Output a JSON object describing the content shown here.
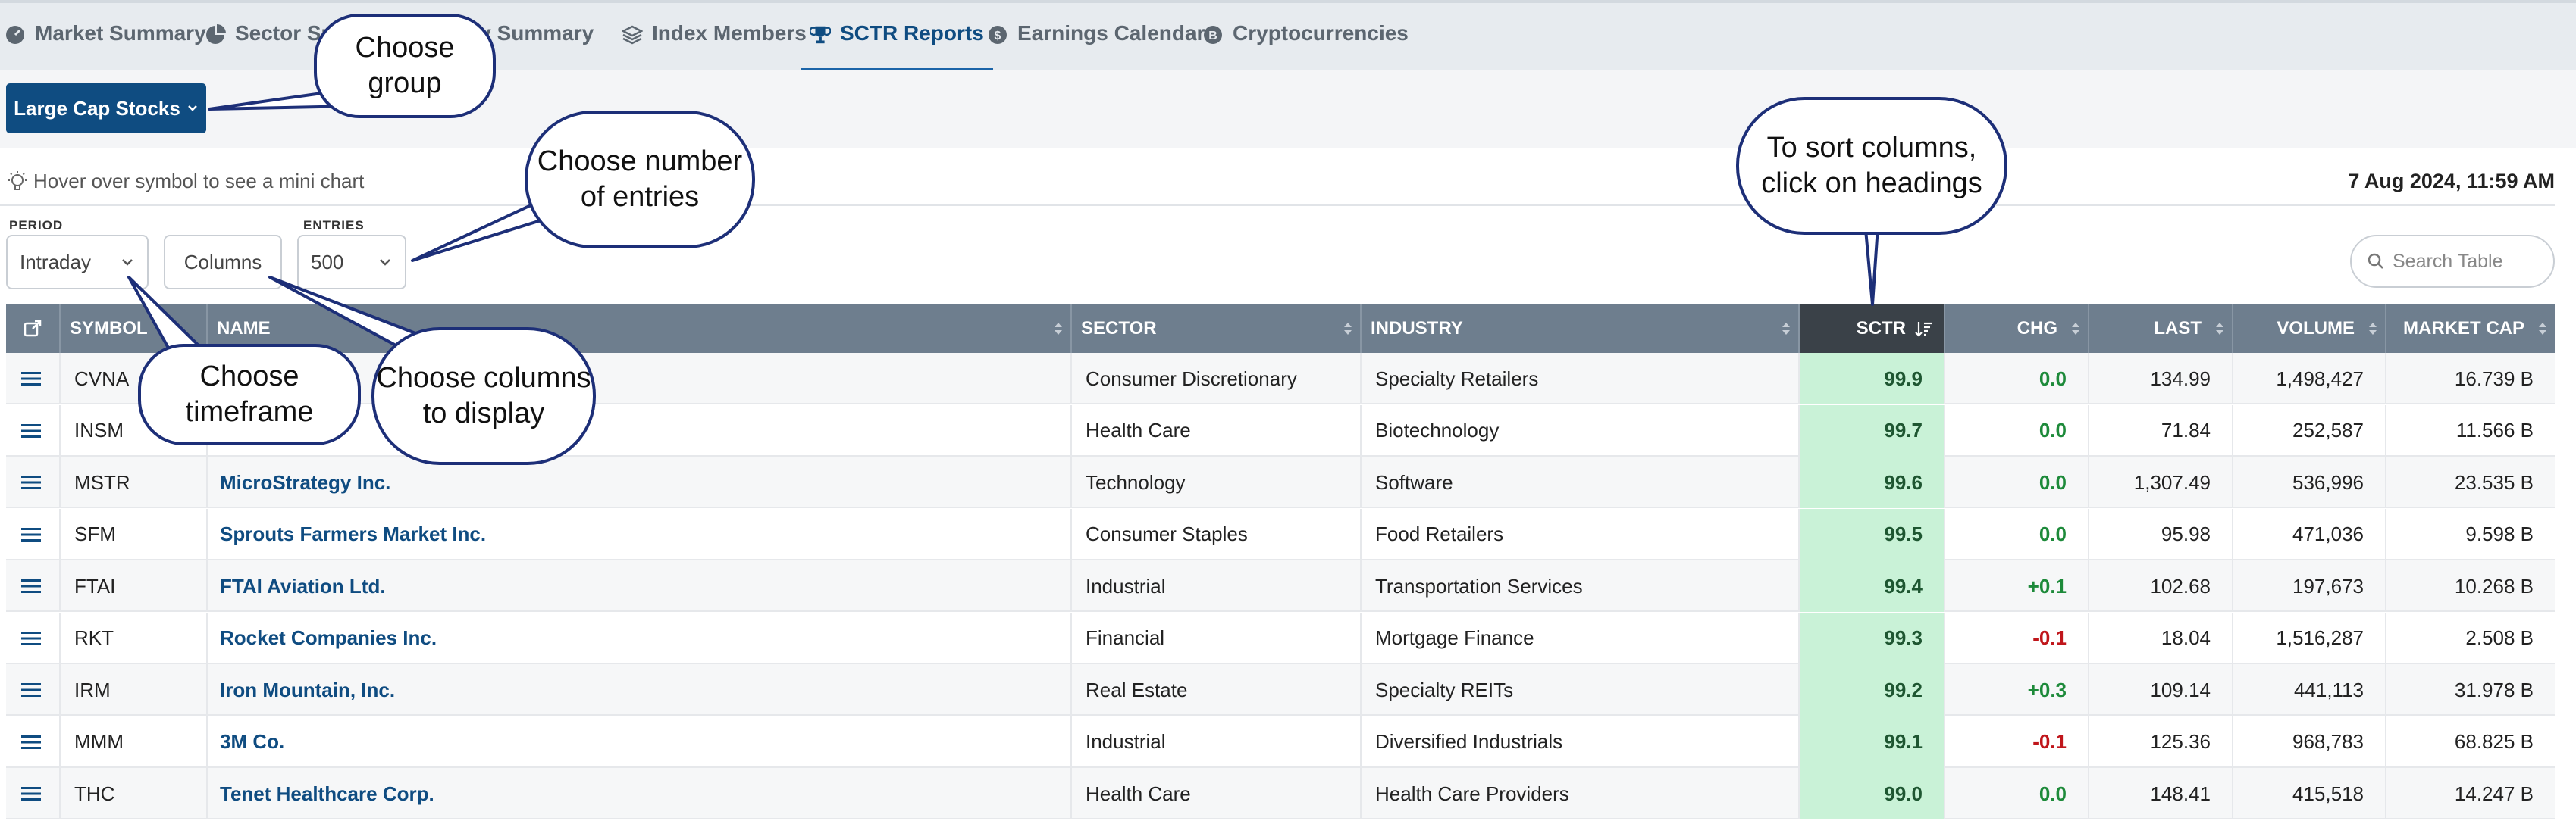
{
  "nav": {
    "tabs": [
      {
        "label": "Market Summary",
        "icon": "gauge-icon"
      },
      {
        "label": "Sector Su",
        "icon": "pie-chart-icon"
      },
      {
        "label": "try Summary",
        "icon": "none"
      },
      {
        "label": "Index Members",
        "icon": "layers-icon"
      },
      {
        "label": "SCTR Reports",
        "icon": "trophy-icon"
      },
      {
        "label": "Earnings Calendar",
        "icon": "dollar-coin-icon"
      },
      {
        "label": "Cryptocurrencies",
        "icon": "bitcoin-icon"
      }
    ],
    "active_index": 4
  },
  "group": {
    "label": "Large Cap Stocks"
  },
  "hint": {
    "text": "Hover over symbol to see a mini chart"
  },
  "timestamp": "7 Aug 2024, 11:59 AM",
  "controls": {
    "period_label": "PERIOD",
    "period_value": "Intraday",
    "columns_label": "Columns",
    "entries_label": "ENTRIES",
    "entries_value": "500",
    "search_placeholder": "Search Table"
  },
  "table": {
    "headers": [
      "SYMBOL",
      "NAME",
      "SECTOR",
      "INDUSTRY",
      "SCTR",
      "CHG",
      "LAST",
      "VOLUME",
      "MARKET CAP"
    ],
    "rows": [
      {
        "symbol": "CVNA",
        "name": "",
        "sector": "Consumer Discretionary",
        "industry": "Specialty Retailers",
        "sctr": "99.9",
        "chg": "0.0",
        "last": "134.99",
        "volume": "1,498,427",
        "mcap": "16.739 B"
      },
      {
        "symbol": "INSM",
        "name": "",
        "sector": "Health Care",
        "industry": "Biotechnology",
        "sctr": "99.7",
        "chg": "0.0",
        "last": "71.84",
        "volume": "252,587",
        "mcap": "11.566 B"
      },
      {
        "symbol": "MSTR",
        "name": "MicroStrategy Inc.",
        "sector": "Technology",
        "industry": "Software",
        "sctr": "99.6",
        "chg": "0.0",
        "last": "1,307.49",
        "volume": "536,996",
        "mcap": "23.535 B"
      },
      {
        "symbol": "SFM",
        "name": "Sprouts Farmers Market Inc.",
        "sector": "Consumer Staples",
        "industry": "Food Retailers",
        "sctr": "99.5",
        "chg": "0.0",
        "last": "95.98",
        "volume": "471,036",
        "mcap": "9.598 B"
      },
      {
        "symbol": "FTAI",
        "name": "FTAI Aviation Ltd.",
        "sector": "Industrial",
        "industry": "Transportation Services",
        "sctr": "99.4",
        "chg": "+0.1",
        "last": "102.68",
        "volume": "197,673",
        "mcap": "10.268 B"
      },
      {
        "symbol": "RKT",
        "name": "Rocket Companies Inc.",
        "sector": "Financial",
        "industry": "Mortgage Finance",
        "sctr": "99.3",
        "chg": "-0.1",
        "last": "18.04",
        "volume": "1,516,287",
        "mcap": "2.508 B"
      },
      {
        "symbol": "IRM",
        "name": "Iron Mountain, Inc.",
        "sector": "Real Estate",
        "industry": "Specialty REITs",
        "sctr": "99.2",
        "chg": "+0.3",
        "last": "109.14",
        "volume": "441,113",
        "mcap": "31.978 B"
      },
      {
        "symbol": "MMM",
        "name": "3M Co.",
        "sector": "Industrial",
        "industry": "Diversified Industrials",
        "sctr": "99.1",
        "chg": "-0.1",
        "last": "125.36",
        "volume": "968,783",
        "mcap": "68.825 B"
      },
      {
        "symbol": "THC",
        "name": "Tenet Healthcare Corp.",
        "sector": "Health Care",
        "industry": "Health Care Providers",
        "sctr": "99.0",
        "chg": "0.0",
        "last": "148.41",
        "volume": "415,518",
        "mcap": "14.247 B"
      }
    ]
  },
  "callouts": {
    "group": "Choose group",
    "entries": "Choose number of entries",
    "sort": "To sort columns, click on headings",
    "timeframe": "Choose timeframe",
    "columns": "Choose columns to display"
  },
  "colors": {
    "brand": "#0f4c81",
    "header_bg": "#6e7e8e",
    "sctr_header": "#3a4148",
    "sctr_cell": "#c9f2d7",
    "positive": "#1d8a3a",
    "negative": "#c0161b",
    "callout_border": "#1d2f78"
  }
}
